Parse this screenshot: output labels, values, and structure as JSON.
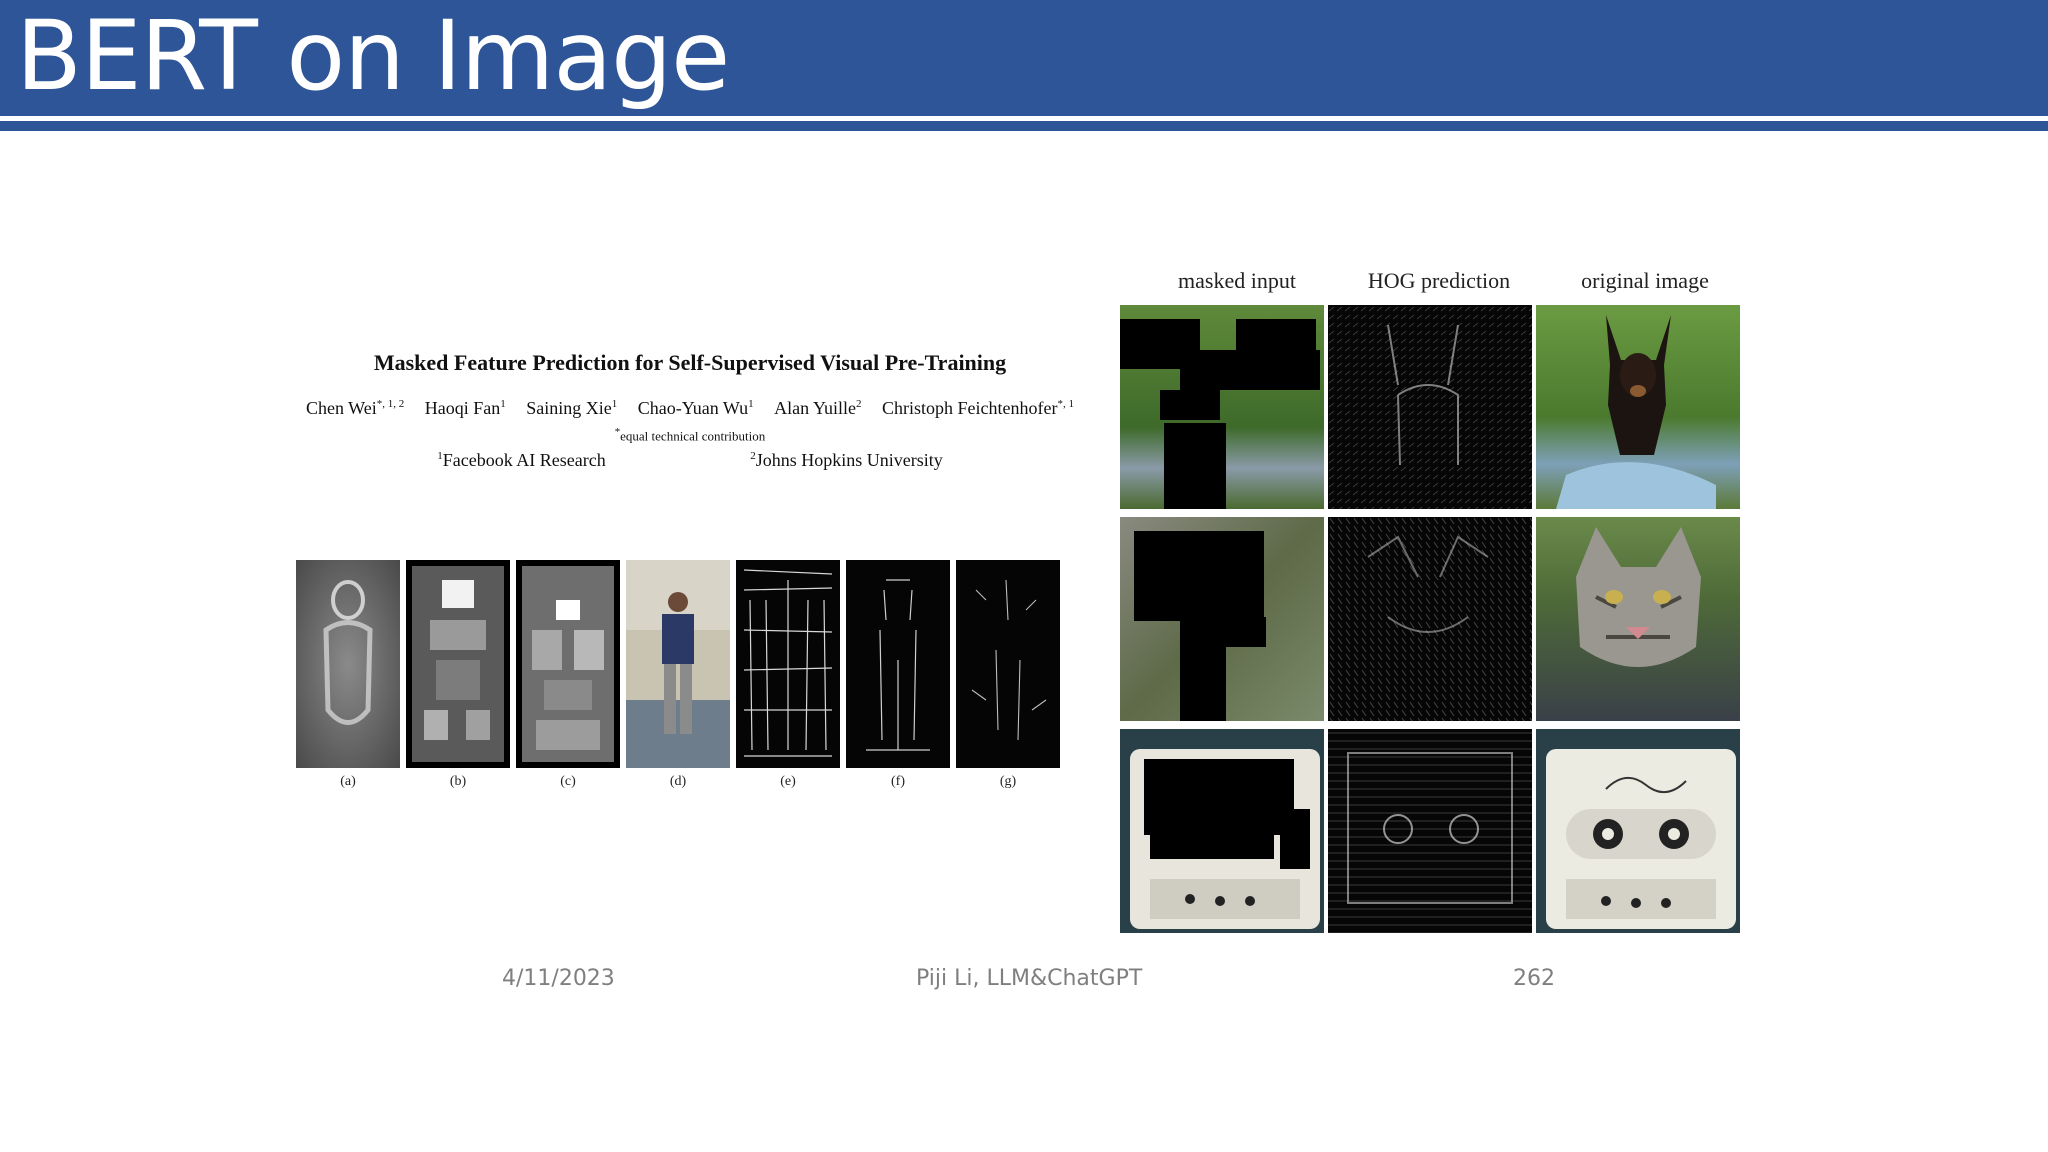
{
  "slide": {
    "title": "BERT on Image",
    "accent_color": "#2e5597"
  },
  "paper": {
    "title": "Masked Feature Prediction for Self-Supervised Visual Pre-Training",
    "authors": [
      {
        "name": "Chen Wei",
        "sup": "*, 1, 2"
      },
      {
        "name": "Haoqi Fan",
        "sup": "1"
      },
      {
        "name": "Saining Xie",
        "sup": "1"
      },
      {
        "name": "Chao-Yuan Wu",
        "sup": "1"
      },
      {
        "name": "Alan Yuille",
        "sup": "2"
      },
      {
        "name": "Christoph Feichtenhofer",
        "sup": "*, 1"
      }
    ],
    "equal_note_sup": "*",
    "equal_note": "equal technical contribution",
    "affiliations": [
      {
        "sup": "1",
        "name": "Facebook AI Research"
      },
      {
        "sup": "2",
        "name": "Johns Hopkins University"
      }
    ]
  },
  "figure_strip": {
    "labels": [
      "(a)",
      "(b)",
      "(c)",
      "(d)",
      "(e)",
      "(f)",
      "(g)"
    ]
  },
  "hog_grid": {
    "columns": [
      "masked input",
      "HOG prediction",
      "original image"
    ],
    "rows": [
      "dog",
      "cat",
      "cassette tape"
    ]
  },
  "footer": {
    "date": "4/11/2023",
    "center": "Piji Li, LLM&ChatGPT",
    "page": "262"
  }
}
